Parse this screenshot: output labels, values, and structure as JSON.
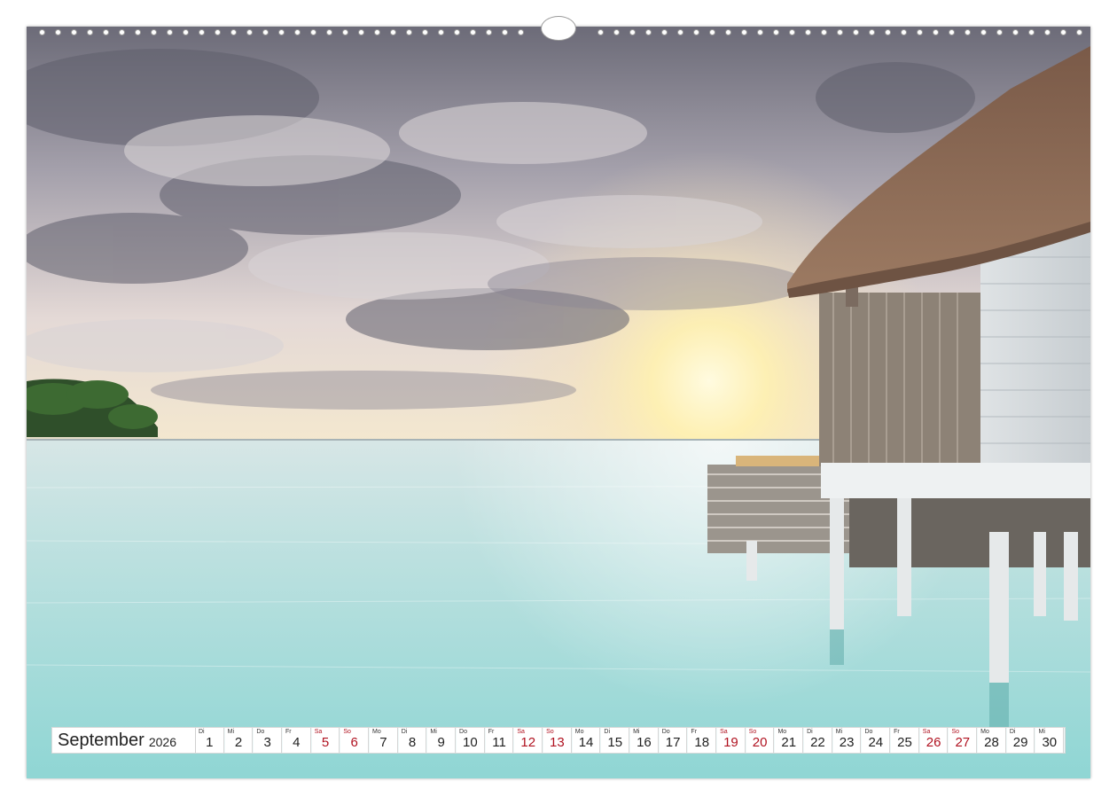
{
  "calendar": {
    "month": "September",
    "year": "2026",
    "days": [
      {
        "wd": "Di",
        "num": "1",
        "we": false
      },
      {
        "wd": "Mi",
        "num": "2",
        "we": false
      },
      {
        "wd": "Do",
        "num": "3",
        "we": false
      },
      {
        "wd": "Fr",
        "num": "4",
        "we": false
      },
      {
        "wd": "Sa",
        "num": "5",
        "we": true
      },
      {
        "wd": "So",
        "num": "6",
        "we": true
      },
      {
        "wd": "Mo",
        "num": "7",
        "we": false
      },
      {
        "wd": "Di",
        "num": "8",
        "we": false
      },
      {
        "wd": "Mi",
        "num": "9",
        "we": false
      },
      {
        "wd": "Do",
        "num": "10",
        "we": false
      },
      {
        "wd": "Fr",
        "num": "11",
        "we": false
      },
      {
        "wd": "Sa",
        "num": "12",
        "we": true
      },
      {
        "wd": "So",
        "num": "13",
        "we": true
      },
      {
        "wd": "Mo",
        "num": "14",
        "we": false
      },
      {
        "wd": "Di",
        "num": "15",
        "we": false
      },
      {
        "wd": "Mi",
        "num": "16",
        "we": false
      },
      {
        "wd": "Do",
        "num": "17",
        "we": false
      },
      {
        "wd": "Fr",
        "num": "18",
        "we": false
      },
      {
        "wd": "Sa",
        "num": "19",
        "we": true
      },
      {
        "wd": "So",
        "num": "20",
        "we": true
      },
      {
        "wd": "Mo",
        "num": "21",
        "we": false
      },
      {
        "wd": "Di",
        "num": "22",
        "we": false
      },
      {
        "wd": "Mi",
        "num": "23",
        "we": false
      },
      {
        "wd": "Do",
        "num": "24",
        "we": false
      },
      {
        "wd": "Fr",
        "num": "25",
        "we": false
      },
      {
        "wd": "Sa",
        "num": "26",
        "we": true
      },
      {
        "wd": "So",
        "num": "27",
        "we": true
      },
      {
        "wd": "Mo",
        "num": "28",
        "we": false
      },
      {
        "wd": "Di",
        "num": "29",
        "we": false
      },
      {
        "wd": "Mi",
        "num": "30",
        "we": false
      }
    ]
  },
  "colors": {
    "weekend": "#b01220",
    "sky_top": "#6f6e7a",
    "sun": "#fff6c8",
    "water": "#a9dbd9",
    "roof": "#8a6a55"
  }
}
